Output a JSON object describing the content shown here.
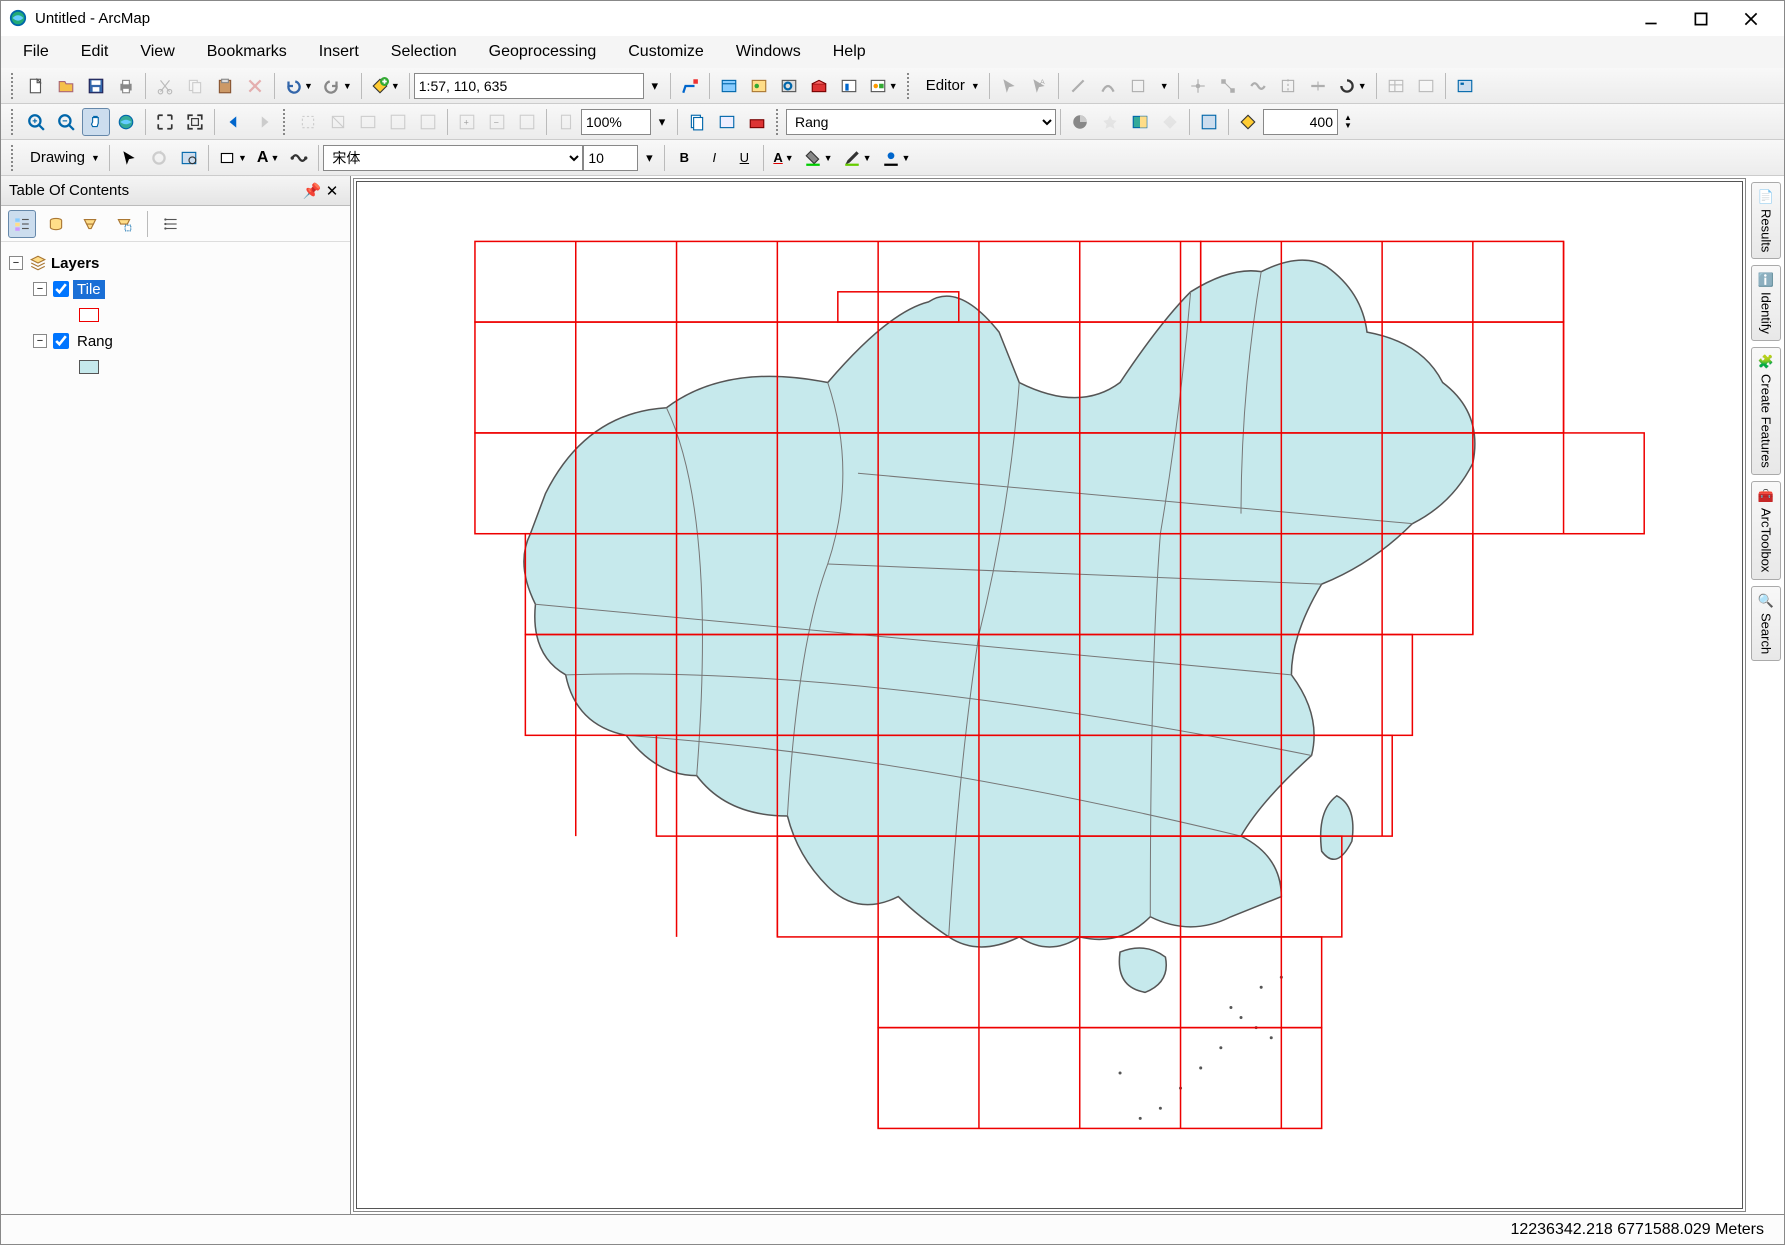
{
  "window": {
    "title": "Untitled - ArcMap"
  },
  "menu": {
    "file": "File",
    "edit": "Edit",
    "view": "View",
    "bookmarks": "Bookmarks",
    "insert": "Insert",
    "selection": "Selection",
    "geoprocessing": "Geoprocessing",
    "customize": "Customize",
    "windows": "Windows",
    "help": "Help"
  },
  "toolbar1": {
    "scale": "1:57, 110, 635",
    "editor_label": "Editor"
  },
  "toolbar2": {
    "zoom_pct": "100%",
    "layer_selected": "Rang",
    "buffer_value": "400"
  },
  "drawing": {
    "label": "Drawing",
    "font": "宋体",
    "font_size": "10",
    "bold": "B",
    "italic": "I",
    "underline": "U"
  },
  "toc": {
    "title": "Table Of Contents",
    "root": "Layers",
    "layer_tile": "Tile",
    "layer_rang": "Rang"
  },
  "side": {
    "results": "Results",
    "identify": "Identify",
    "create_features": "Create Features",
    "arctoolbox": "ArcToolbox",
    "search": "Search"
  },
  "status": {
    "coords": "12236342.218  6771588.029 Meters"
  }
}
